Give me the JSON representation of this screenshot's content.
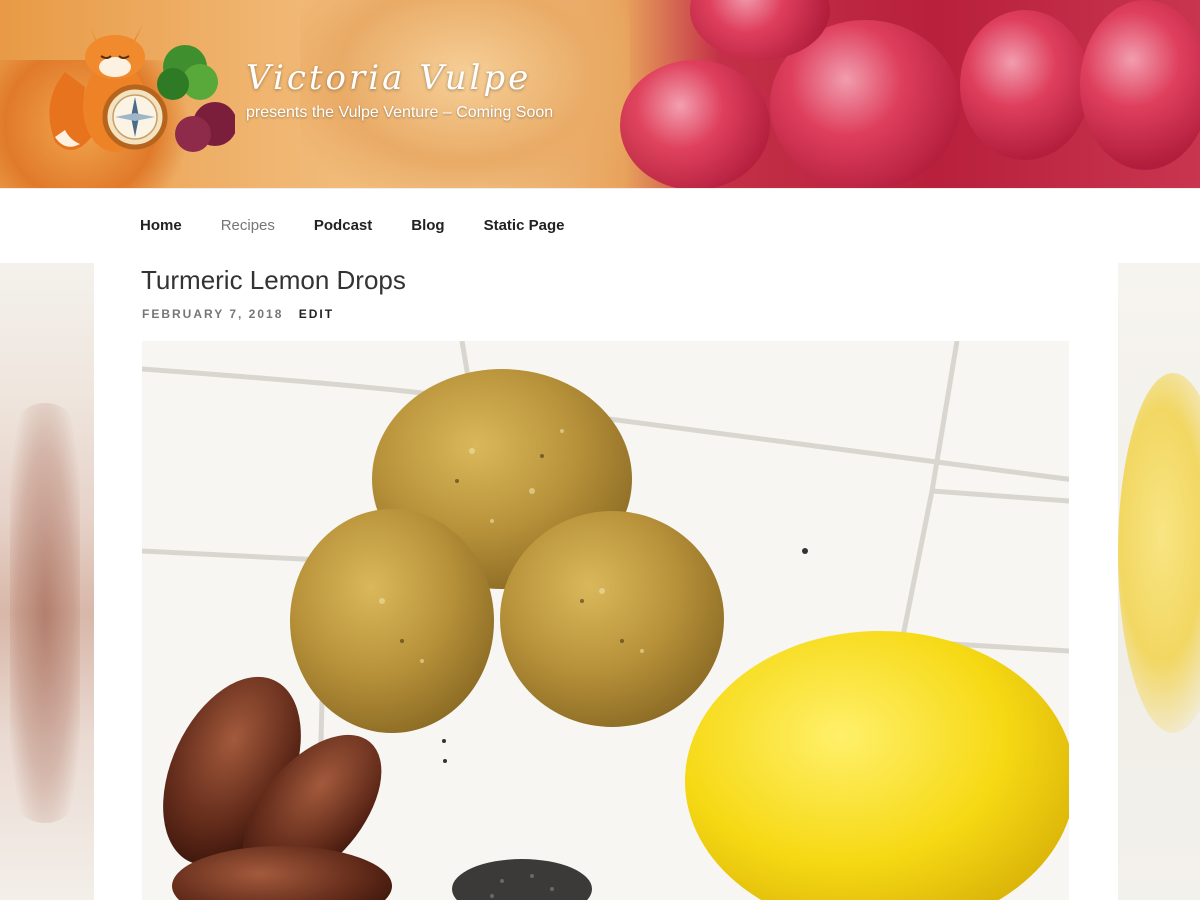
{
  "header": {
    "site_title": "Victoria Vulpe",
    "site_description": "presents the Vulpe Venture – Coming Soon"
  },
  "nav": {
    "items": [
      {
        "label": "Home",
        "current": false
      },
      {
        "label": "Recipes",
        "current": true
      },
      {
        "label": "Podcast",
        "current": false
      },
      {
        "label": "Blog",
        "current": false
      },
      {
        "label": "Static Page",
        "current": false
      }
    ]
  },
  "post": {
    "title": "Turmeric Lemon Drops",
    "date": "FEBRUARY 7, 2018",
    "edit_label": "EDIT"
  },
  "colors": {
    "title_color": "#ffffff",
    "nav_current": "#767676",
    "accent_lemon": "#f4d81f",
    "accent_turmeric": "#c9a441"
  }
}
